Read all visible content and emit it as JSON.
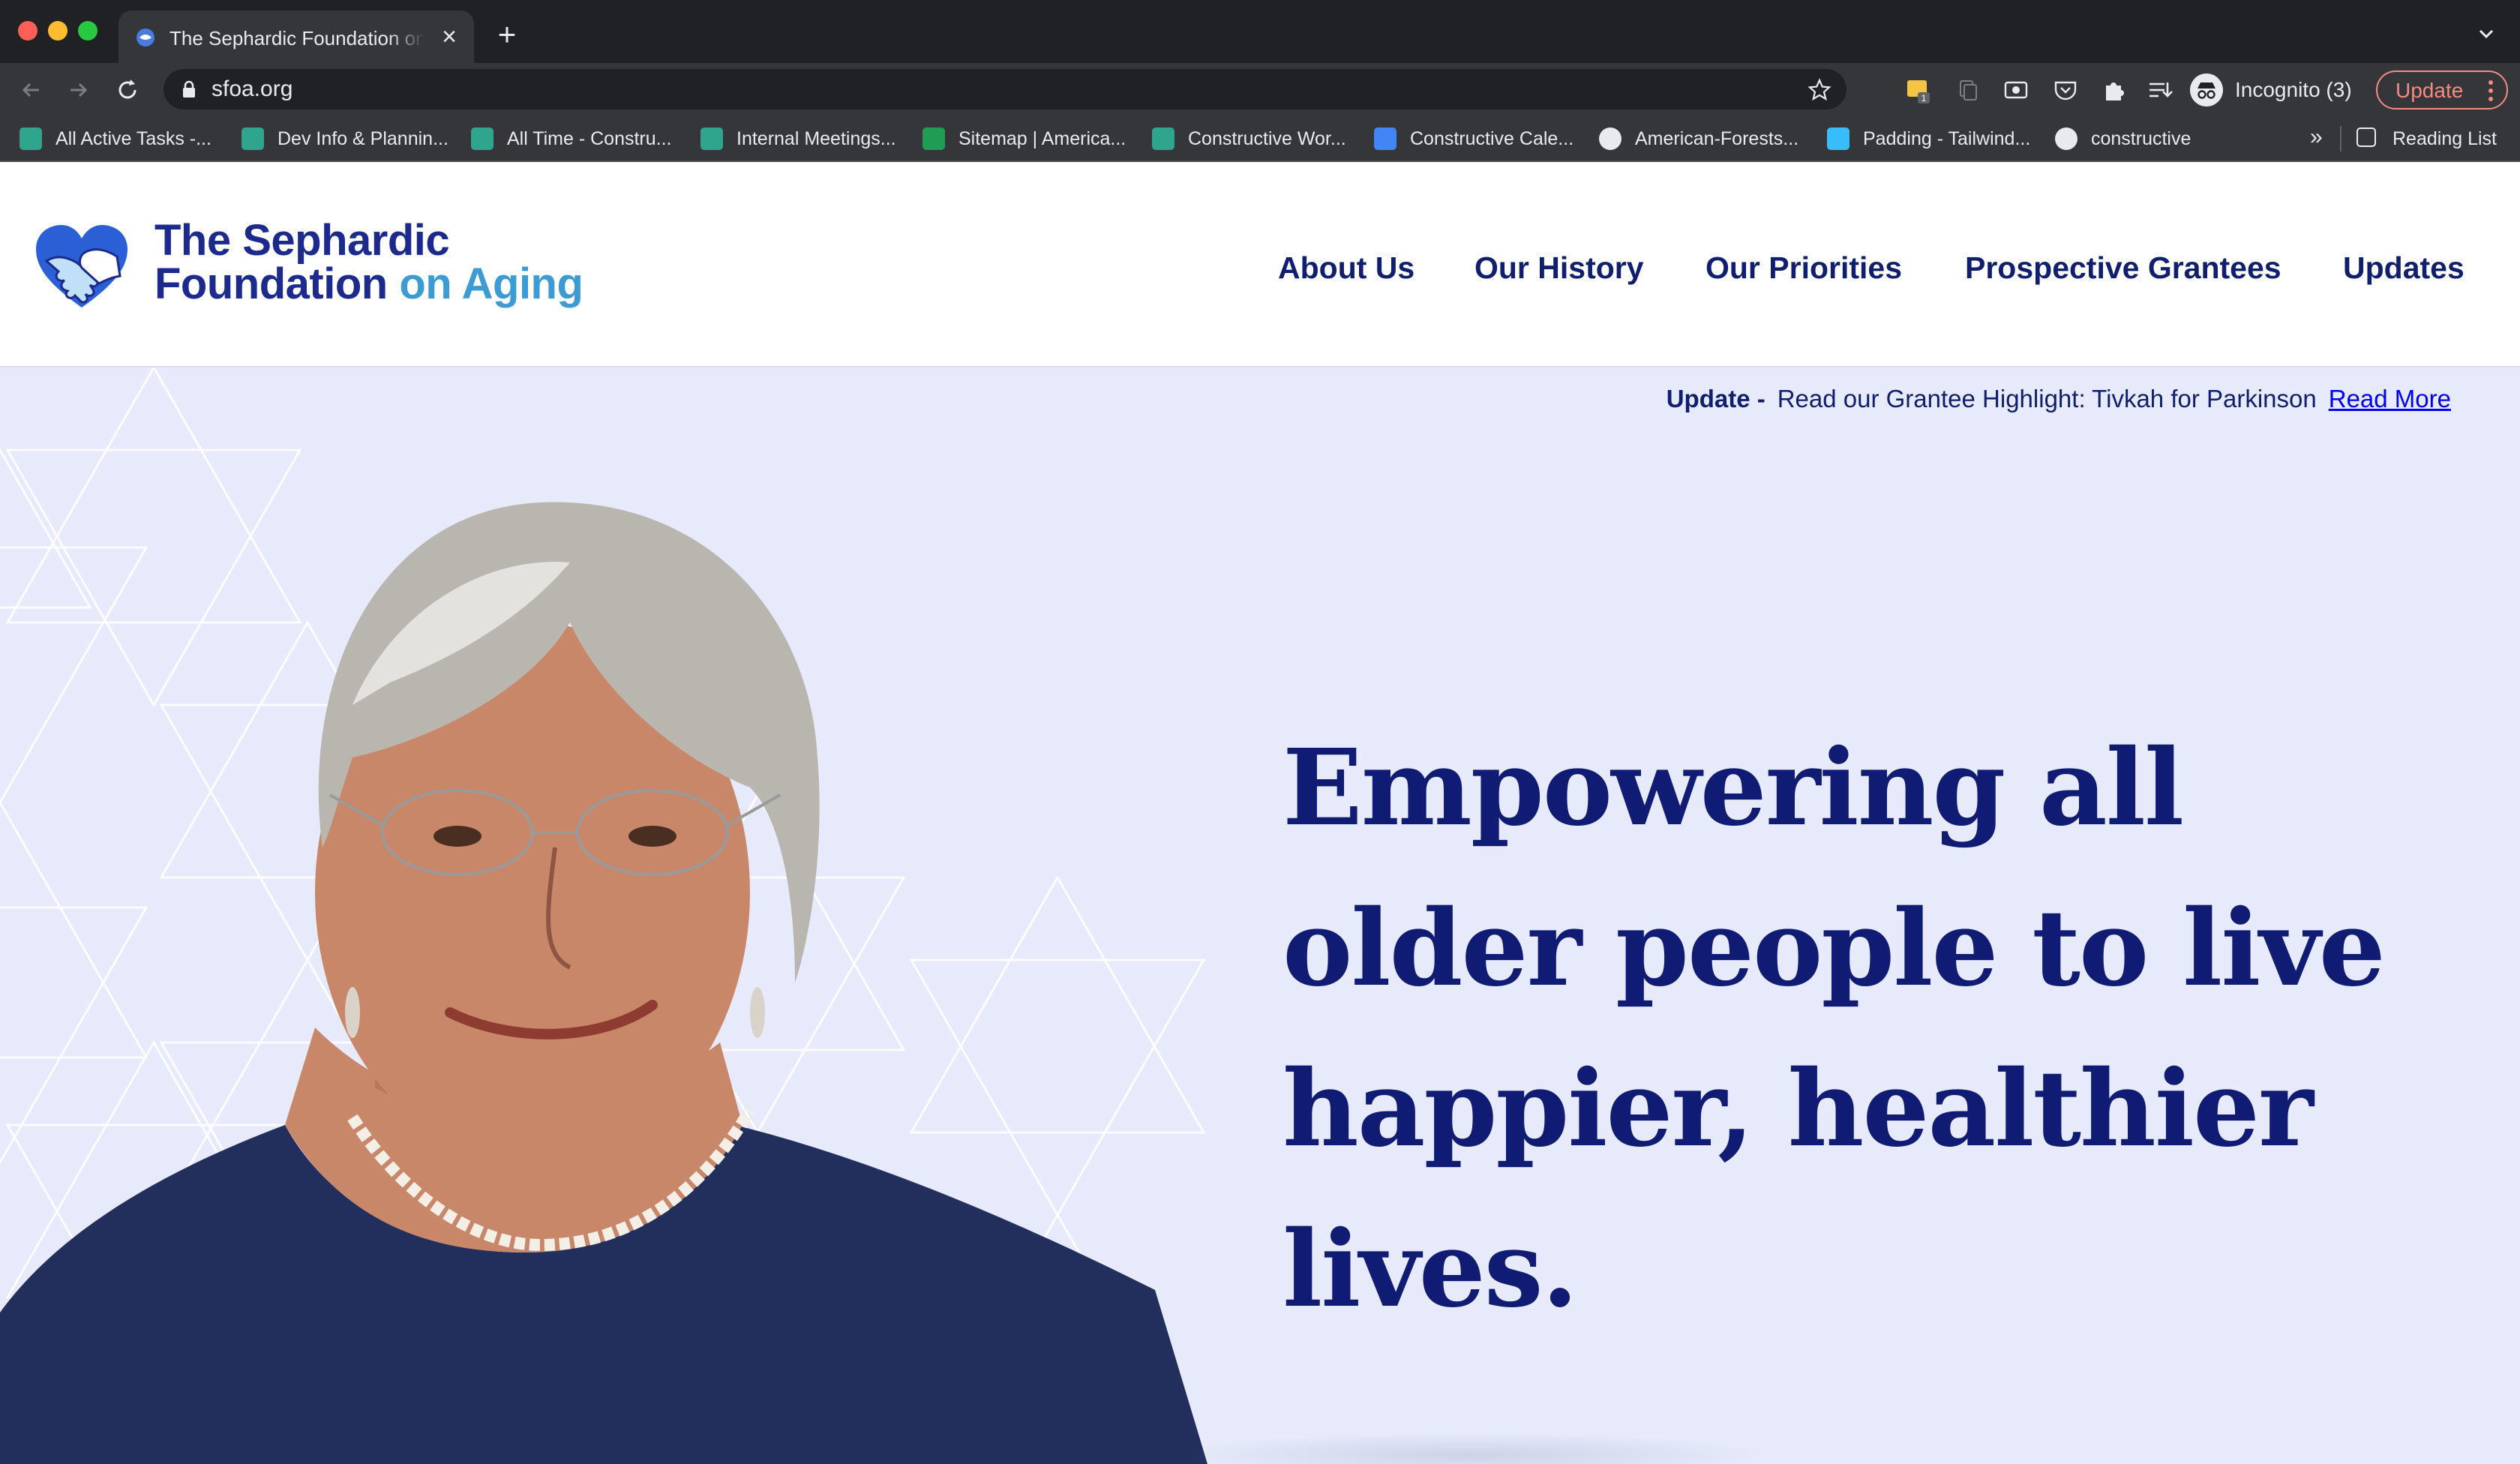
{
  "browser": {
    "tab_title": "The Sephardic Foundation on Aging",
    "url": "sfoa.org",
    "profile_label": "Incognito (3)",
    "update_label": "Update",
    "bookmarks": [
      {
        "label": "All Active Tasks -...",
        "icon": "constructive-icon"
      },
      {
        "label": "Dev Info & Plannin...",
        "icon": "constructive-icon"
      },
      {
        "label": "All Time - Constru...",
        "icon": "constructive-icon"
      },
      {
        "label": "Internal Meetings...",
        "icon": "constructive-icon"
      },
      {
        "label": "Sitemap | America...",
        "icon": "sheets-icon"
      },
      {
        "label": "Constructive Wor...",
        "icon": "constructive-icon"
      },
      {
        "label": "Constructive Cale...",
        "icon": "calendar-icon"
      },
      {
        "label": "American-Forests...",
        "icon": "github-icon"
      },
      {
        "label": "Padding - Tailwind...",
        "icon": "tailwind-icon"
      },
      {
        "label": "constructive",
        "icon": "github-icon"
      }
    ],
    "overflow_label": "»",
    "reading_list_label": "Reading List",
    "extension_badge": "1"
  },
  "site": {
    "logo_line1": "The Sephardic",
    "logo_line2_main": "Foundation",
    "logo_line2_accent": "on Aging",
    "nav": [
      "About Us",
      "Our History",
      "Our Priorities",
      "Prospective Grantees",
      "Updates"
    ],
    "update_tag": "Update -",
    "update_text": "Read our Grantee Highlight: Tivkah for Parkinson",
    "update_link": "Read More",
    "headline": "Empowering all older people to live happier, healthier lives."
  },
  "colors": {
    "brand_navy": "#101c74",
    "brand_blue": "#3d9bd4",
    "hero_bg": "#e6eafa"
  }
}
